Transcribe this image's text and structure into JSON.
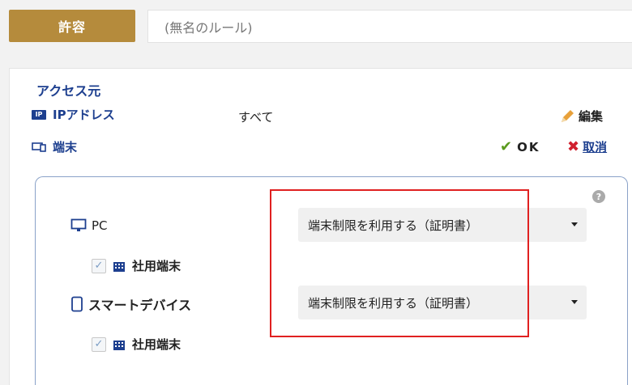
{
  "header": {
    "action_label": "許容",
    "rule_name_placeholder": "(無名のルール)"
  },
  "access_source": {
    "title": "アクセス元",
    "ip_row": {
      "icon_text": "IP",
      "label": "IPアドレス",
      "value": "すべて",
      "edit_label": "編集"
    },
    "device_row": {
      "label": "端末",
      "ok_label": "OK",
      "cancel_label": "取消"
    }
  },
  "devices": [
    {
      "label": "PC",
      "select_value": "端末制限を利用する（証明書）",
      "sub_item_label": "社用端末",
      "sub_item_checked": true
    },
    {
      "label": "スマートデバイス",
      "select_value": "端末制限を利用する（証明書）",
      "sub_item_label": "社用端末",
      "sub_item_checked": true
    }
  ],
  "help_label": "?",
  "colors": {
    "accent": "#b58b3c",
    "link": "#1d3f8f",
    "ok": "#5a9a1e",
    "cancel": "#d0202e",
    "highlight": "#e02020"
  }
}
